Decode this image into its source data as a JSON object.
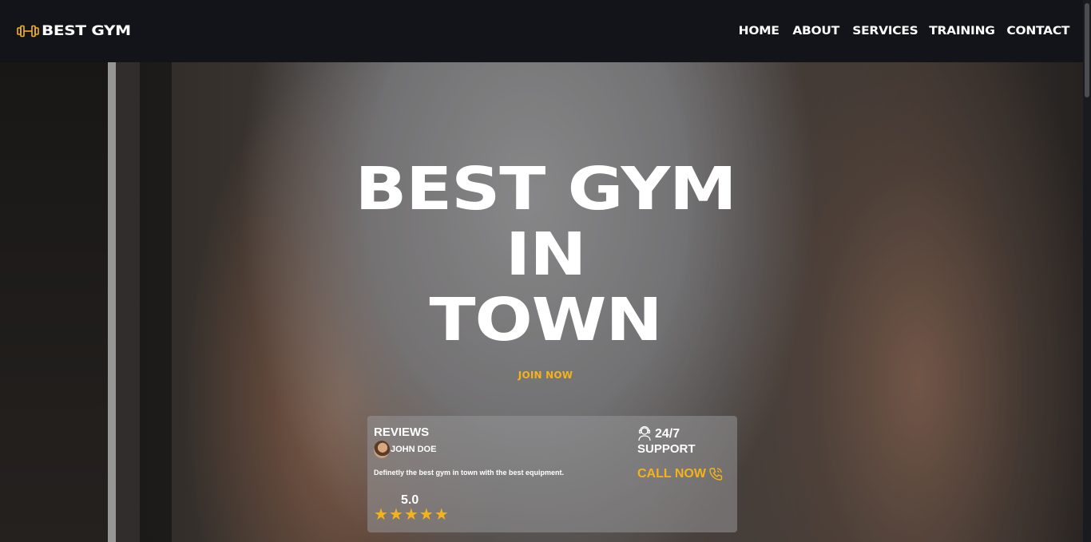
{
  "brand": {
    "name": "BEST GYM",
    "logo_icon": "dumbbell-icon",
    "accent_color": "#f5b319"
  },
  "nav": {
    "items": [
      {
        "label": "HOME"
      },
      {
        "label": "ABOUT"
      },
      {
        "label": "SERVICES"
      },
      {
        "label": "TRAINING"
      },
      {
        "label": "CONTACT"
      }
    ]
  },
  "hero": {
    "title_lines": [
      "BEST GYM",
      "IN",
      "TOWN"
    ],
    "cta_label": "JOIN NOW"
  },
  "reviews": {
    "title": "REVIEWS",
    "reviewer_name": "JOHN DOE",
    "text": "Definetly the best gym in town with the best equipment.",
    "rating": "5.0",
    "stars": 5
  },
  "support": {
    "hours": "24/7",
    "label": "SUPPORT",
    "call_label": "CALL NOW",
    "icons": [
      "support-agent-icon",
      "phone-icon"
    ]
  }
}
